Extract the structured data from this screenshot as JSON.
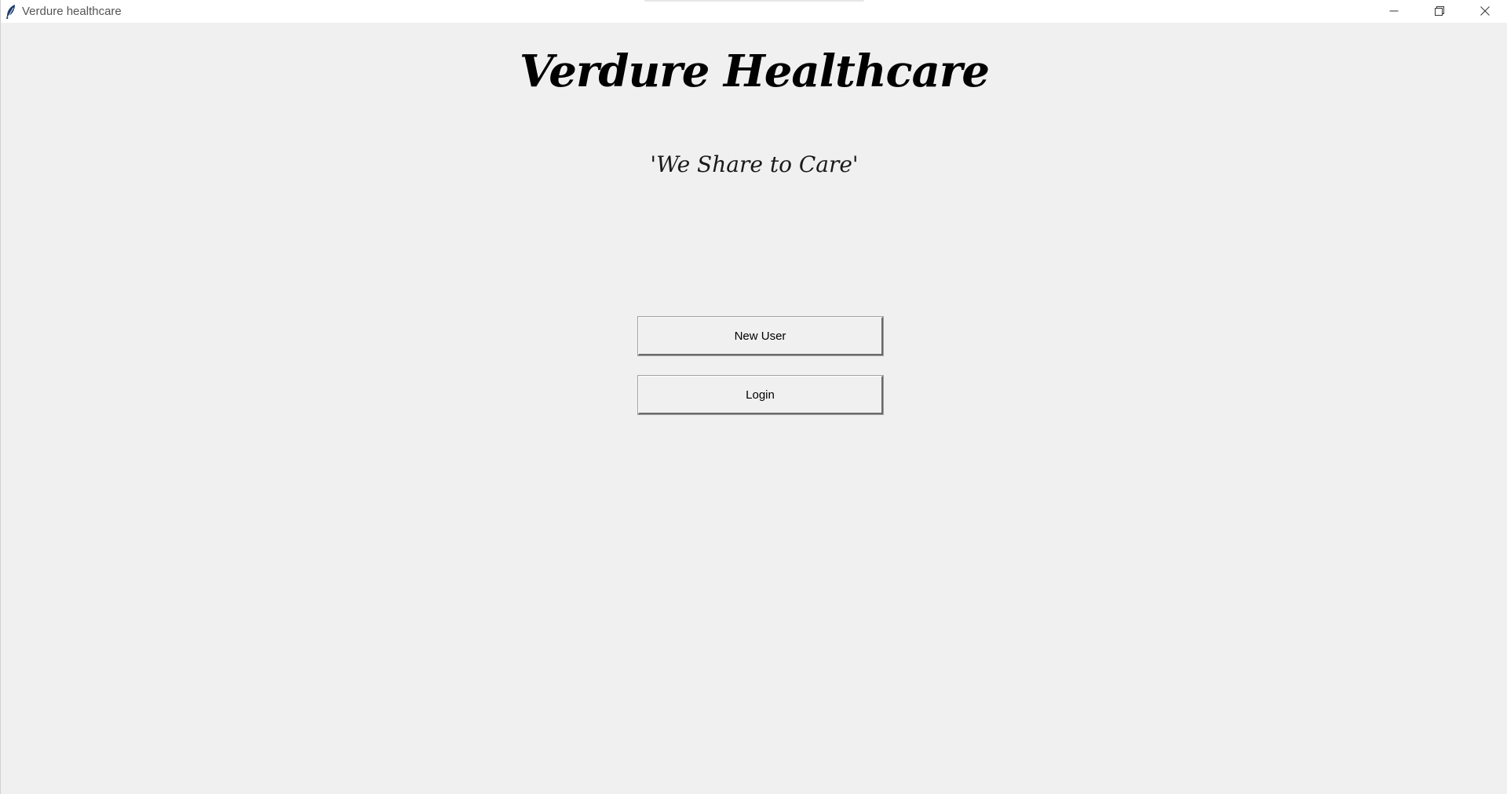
{
  "window": {
    "title": "Verdure healthcare",
    "app_icon": "feather-icon",
    "controls": [
      "minimize-icon",
      "restore-icon",
      "close-icon"
    ]
  },
  "main": {
    "heading": "Verdure Healthcare",
    "tagline": "'We Share to Care'",
    "buttons": {
      "new_user": "New User",
      "login": "Login"
    }
  }
}
